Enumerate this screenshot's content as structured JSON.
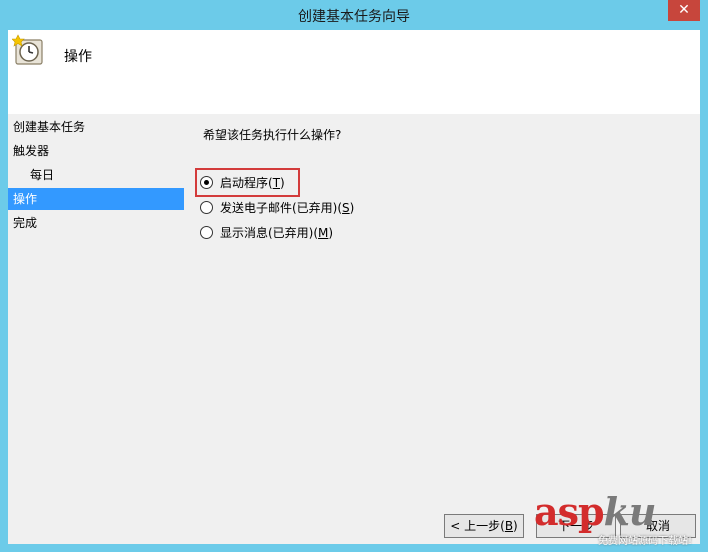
{
  "window": {
    "title": "创建基本任务向导",
    "close_label": "✕"
  },
  "header": {
    "title": "操作",
    "icon": "clock-icon"
  },
  "sidebar": {
    "items": [
      {
        "label": "创建基本任务"
      },
      {
        "label": "触发器"
      },
      {
        "label": "每日"
      },
      {
        "label": "操作"
      },
      {
        "label": "完成"
      }
    ]
  },
  "content": {
    "question": "希望该任务执行什么操作?",
    "options": [
      {
        "label": "启动程序(",
        "hotkey": "T",
        "suffix": ")",
        "checked": true
      },
      {
        "label": "发送电子邮件(已弃用)(",
        "hotkey": "S",
        "suffix": ")",
        "checked": false
      },
      {
        "label": "显示消息(已弃用)(",
        "hotkey": "M",
        "suffix": ")",
        "checked": false
      }
    ]
  },
  "footer": {
    "back_label": "< 上一步(",
    "back_hotkey": "B",
    "back_suffix": ")",
    "next_label": "下一步",
    "cancel_label": "取消"
  },
  "watermark": {
    "main_red": "asp",
    "main_grey": "ku",
    "sub": "免费网站源码下载站!"
  },
  "colors": {
    "titlebar": "#6ccbe9",
    "selection": "#3399ff",
    "highlight": "#d33b3b",
    "close": "#c7463c"
  }
}
